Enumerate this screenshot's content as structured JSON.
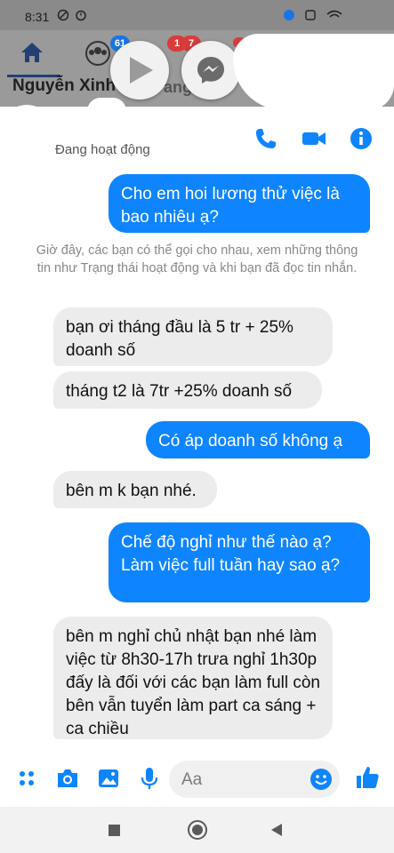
{
  "status_bar": {
    "time": "8:31"
  },
  "fb_header": {
    "name": "Nguyễn Xinh",
    "badges": [
      "61",
      "1",
      "7"
    ]
  },
  "chat_header": {
    "status": "Đang hoạt động"
  },
  "messages": [
    {
      "direction": "out",
      "text": "Cho em hoi lương thử việc là bao nhiêu ạ?"
    },
    {
      "direction": "in",
      "text": "bạn ơi tháng đầu là 5 tr + 25% doanh số"
    },
    {
      "direction": "in",
      "text": "tháng t2 là 7tr +25% doanh số"
    },
    {
      "direction": "out",
      "text": "Có áp doanh số không ạ"
    },
    {
      "direction": "in",
      "text": "bên m k bạn nhé."
    },
    {
      "direction": "out",
      "text": "Chế độ nghỉ như thế nào ạ? Làm việc full tuần hay sao ạ?"
    },
    {
      "direction": "in",
      "text": "bên m nghỉ chủ nhật bạn nhé làm việc từ 8h30-17h trưa nghỉ 1h30p đấy là đối với các bạn làm full còn bên vẫn tuyển làm part ca sáng + ca chiều"
    }
  ],
  "info_notice": "Giờ đây, các bạn có thể gọi cho nhau, xem những thông tin như Trạng thái hoạt động và khi bạn đã đọc tin nhắn.",
  "composer": {
    "placeholder": "Aa"
  },
  "colors": {
    "accent": "#0f84ff",
    "incoming": "#ececec"
  }
}
